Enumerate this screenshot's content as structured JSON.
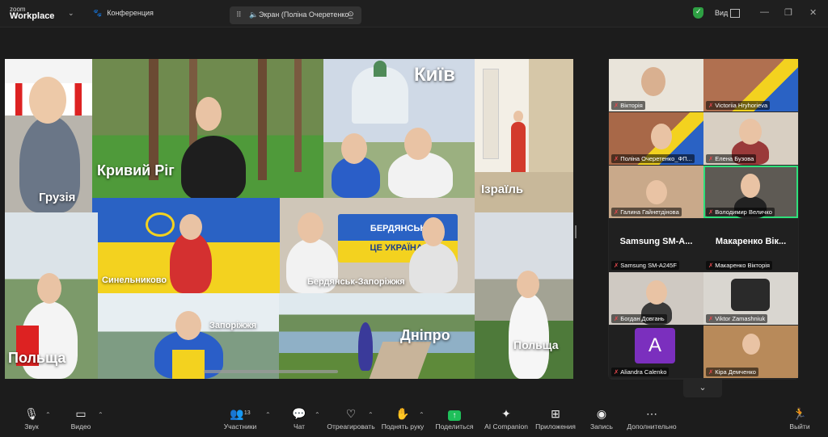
{
  "titlebar": {
    "brand_top": "zoom",
    "brand_bottom": "Workplace",
    "meeting_title": "Конференция",
    "share_tab": "Экран (Поліна Очеретенко_",
    "view_label": "Вид"
  },
  "screen": {
    "labels": {
      "georgia": "Грузія",
      "kryvyi_rih": "Кривий Ріг",
      "kyiv": "Київ",
      "israel": "Ізраїль",
      "synelnykove": "Синельниково",
      "berdiansk_banner_1": "БЕРДЯНСЬК",
      "berdiansk_banner_2": "ЦЕ УКРАЇНА!",
      "berdiansk": "Бердянськ-Запоріжжя",
      "poland_left": "Польща",
      "zaporizhzhia": "Запоріжжя",
      "dnipro": "Дніпро",
      "poland_right": "Польща"
    }
  },
  "gallery": {
    "participants": [
      {
        "name": "Вікторія"
      },
      {
        "name": "Victoriia Hryhorieva"
      },
      {
        "name": "Поліна Очеретенко_ФП..."
      },
      {
        "name": "Елена Бузова"
      },
      {
        "name": "Галина Гайнетдінова"
      },
      {
        "name": "Володимир Величко"
      },
      {
        "name": "Samsung SM-A245F",
        "big": "Samsung SM-A..."
      },
      {
        "name": "Макаренко Вікторія",
        "big": "Макаренко Вік..."
      },
      {
        "name": "Богдан Довгань"
      },
      {
        "name": "Viktor Zamashniuk"
      },
      {
        "name": "Aliandra Calenko",
        "avatar": "A"
      },
      {
        "name": "Кіра Демченко"
      }
    ]
  },
  "toolbar": {
    "audio": "Звук",
    "video": "Видео",
    "participants": "Участники",
    "participants_count": "13",
    "chat": "Чат",
    "react": "Отреагировать",
    "raise_hand": "Поднять руку",
    "share": "Поделиться",
    "ai": "AI Companion",
    "apps": "Приложения",
    "record": "Запись",
    "more": "Дополнительно",
    "leave": "Выйти"
  },
  "colors": {
    "accent_green": "#2ee07a",
    "mute_red": "#e5484d",
    "share_green": "#1fbf5a",
    "avatar_purple": "#7b2fbe"
  }
}
